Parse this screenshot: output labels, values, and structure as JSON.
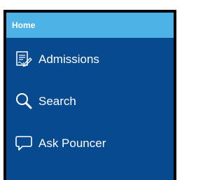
{
  "sidebar": {
    "header": {
      "title": "Home"
    },
    "items": [
      {
        "label": "Admissions",
        "icon": "admissions-form-icon"
      },
      {
        "label": "Search",
        "icon": "search-icon"
      },
      {
        "label": "Ask Pouncer",
        "icon": "chat-bubble-icon"
      }
    ]
  },
  "colors": {
    "header_bg": "#4db3e6",
    "panel_bg": "#074a8f",
    "text": "#ffffff",
    "border": "#000000"
  }
}
